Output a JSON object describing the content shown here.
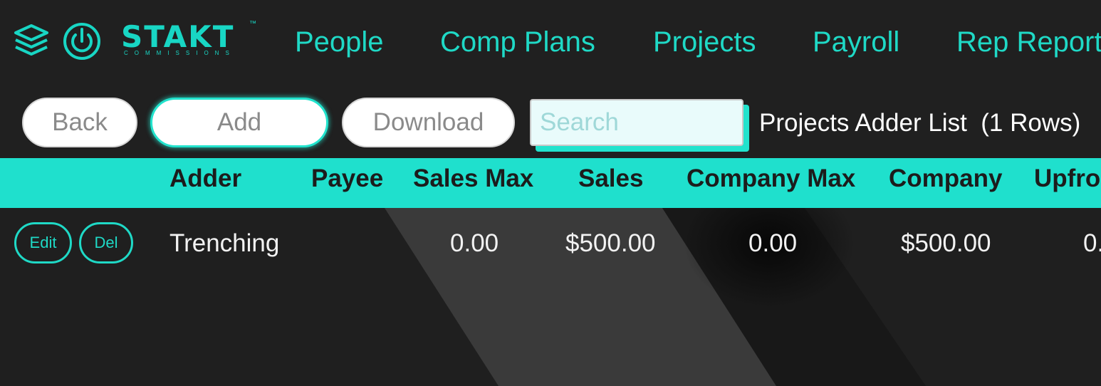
{
  "brand": {
    "name": "STAKT",
    "tm": "™",
    "tagline": "COMMISSIONS"
  },
  "nav": {
    "links": [
      "People",
      "Comp Plans",
      "Projects",
      "Payroll",
      "Rep Report"
    ]
  },
  "toolbar": {
    "back_label": "Back",
    "add_label": "Add",
    "download_label": "Download",
    "search_placeholder": "Search",
    "list_title": "Projects Adder List  (1 Rows)"
  },
  "table": {
    "headers": [
      "Adder",
      "Payee",
      "Sales Max",
      "Sales",
      "Company Max",
      "Company",
      "Upfro"
    ],
    "rows": [
      {
        "edit_label": "Edit",
        "del_label": "Del",
        "adder": "Trenching",
        "payee": "",
        "sales_max": "0.00",
        "sales": "$500.00",
        "company_max": "0.00",
        "company": "$500.00",
        "upfront": "0."
      }
    ]
  },
  "colors": {
    "accent": "#1fe0cd",
    "background": "#202020",
    "text_light": "#f2f2f2"
  },
  "icons": {
    "stack": "layers-icon",
    "power": "power-icon"
  }
}
